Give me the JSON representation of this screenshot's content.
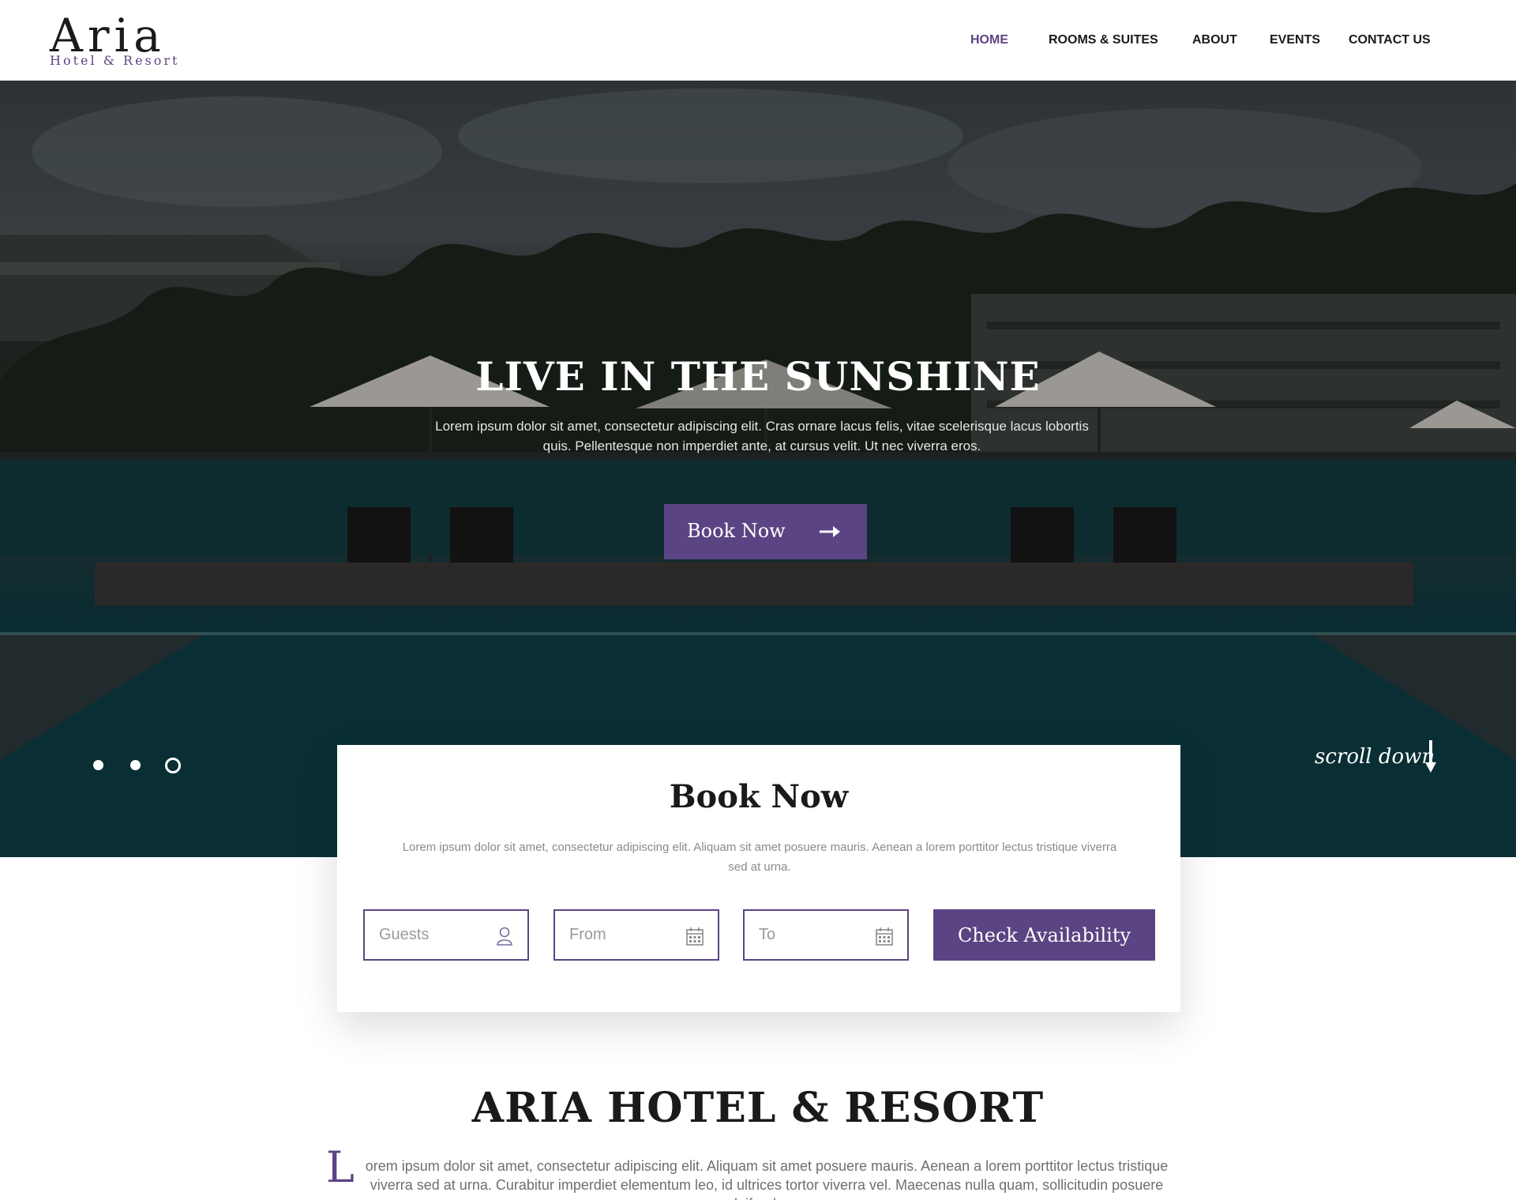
{
  "brand": {
    "name": "Aria",
    "tagline": "Hotel & Resort",
    "accent_color": "#5b4483"
  },
  "nav": {
    "items": [
      {
        "label": "HOME",
        "active": true
      },
      {
        "label": "ROOMS & SUITES",
        "active": false
      },
      {
        "label": "ABOUT",
        "active": false
      },
      {
        "label": "EVENTS",
        "active": false
      },
      {
        "label": "CONTACT US",
        "active": false
      }
    ]
  },
  "hero": {
    "heading": "LIVE IN THE SUNSHINE",
    "text": "Lorem ipsum dolor sit amet, consectetur adipiscing elit. Cras ornare lacus felis, vitae scelerisque lacus lobortis quis. Pellentesque non imperdiet ante, at cursus velit. Ut nec viverra eros.",
    "button_label": "Book Now",
    "button_icon": "arrow-right-icon",
    "slider": {
      "count": 3,
      "active_index": 2
    },
    "scroll_label": "scroll down",
    "scroll_icon": "arrow-down-icon"
  },
  "booking": {
    "title": "Book Now",
    "text": "Lorem ipsum dolor sit amet, consectetur adipiscing elit. Aliquam sit amet posuere mauris. Aenean a lorem porttitor lectus tristique viverra sed at urna.",
    "guests_placeholder": "Guests",
    "guests_icon": "user-icon",
    "from_placeholder": "From",
    "from_icon": "calendar-icon",
    "to_placeholder": "To",
    "to_icon": "calendar-icon",
    "check_label": "Check Availability"
  },
  "about": {
    "title": "ARIA HOTEL & RESORT",
    "dropcap": "L",
    "text": "orem ipsum dolor sit amet, consectetur adipiscing elit. Aliquam sit amet posuere mauris. Aenean a lorem porttitor lectus tristique viverra sed at urna. Curabitur imperdiet elementum leo, id ultrices tortor viverra vel. Maecenas nulla quam, sollicitudin posuere eleifend nec,"
  }
}
